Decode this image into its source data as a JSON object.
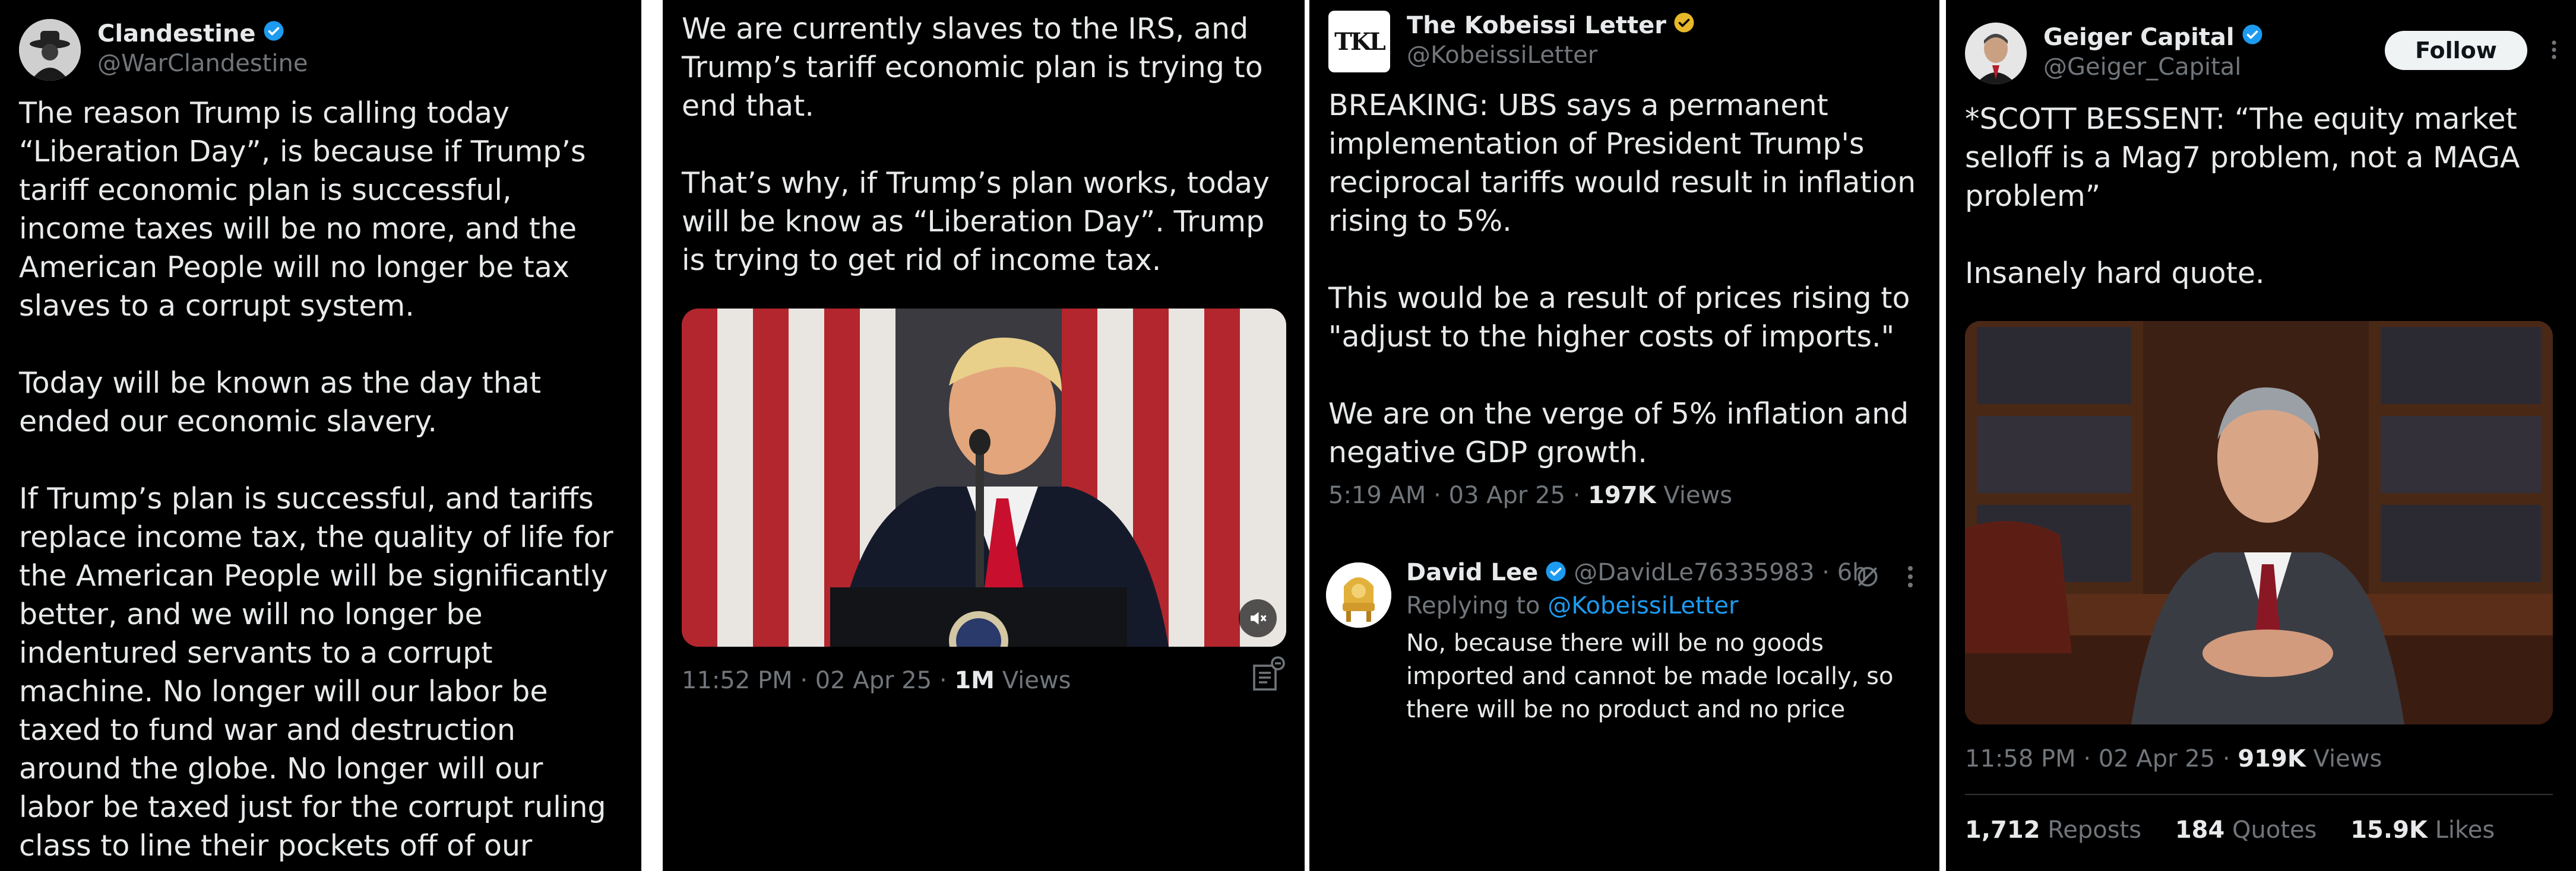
{
  "tweet1": {
    "display_name": "Clandestine",
    "handle": "@WarClandestine",
    "text": "The reason Trump is calling today “Liberation Day”, is because if Trump’s tariff economic plan is successful, income taxes will be no more, and the American People will no longer be tax slaves to a corrupt system.\n\nToday will be known as the day that ended our economic slavery.\n\nIf Trump’s plan is successful, and tariffs replace income tax, the quality of life for the American People will be significantly better, and we will no longer be indentured servants to a corrupt machine. No longer will our labor be taxed to fund war and destruction around the globe. No longer will our labor be taxed just for the corrupt ruling class to line their pockets off of our suffering."
  },
  "tweet2": {
    "text": "We are currently slaves to the IRS, and Trump’s tariff economic plan is trying to end that.\n\nThat’s why, if Trump’s plan works, today will be know as “Liberation Day”. Trump is trying to get rid of income tax.",
    "time": "11:52 PM · 02 Apr 25 · ",
    "views_count": "1M",
    "views_label": " Views"
  },
  "tweet3": {
    "display_name": "The Kobeissi Letter",
    "handle": "@KobeissiLetter",
    "avatar_text": "TKL",
    "text": "BREAKING: UBS says a permanent implementation of President Trump's reciprocal tariffs would result in inflation rising to 5%.\n\nThis would be a result of prices rising to \"adjust to the higher costs of imports.\"\n\nWe are on the verge of 5% inflation and negative GDP growth.",
    "time": "5:19 AM · 03 Apr 25 · ",
    "views_count": "197K",
    "views_label": " Views",
    "reply": {
      "display_name": "David Lee",
      "handle": "@DavidLe76335983 · 6h",
      "replying_prefix": "Replying to ",
      "replying_to": "@KobeissiLetter",
      "text": "No, because there will be no goods imported and cannot be made locally, so there will be no product and no price"
    }
  },
  "tweet4": {
    "display_name": "Geiger Capital",
    "handle": "@Geiger_Capital",
    "follow_label": "Follow",
    "text": "*SCOTT BESSENT: “The equity market selloff is a Mag7 problem, not a MAGA problem”\n\nInsanely hard quote.",
    "time": "11:58 PM · 02 Apr 25 · ",
    "views_count": "919K",
    "views_label": " Views",
    "reposts_count": "1,712",
    "reposts_label": "Reposts",
    "quotes_count": "184",
    "quotes_label": "Quotes",
    "likes_count": "15.9K",
    "likes_label": "Likes"
  },
  "colors": {
    "background": "#000000",
    "text": "#e7e9ea",
    "secondary": "#71767b",
    "verified_blue": "#1d9bf0",
    "verified_gold": "#e8b829"
  }
}
